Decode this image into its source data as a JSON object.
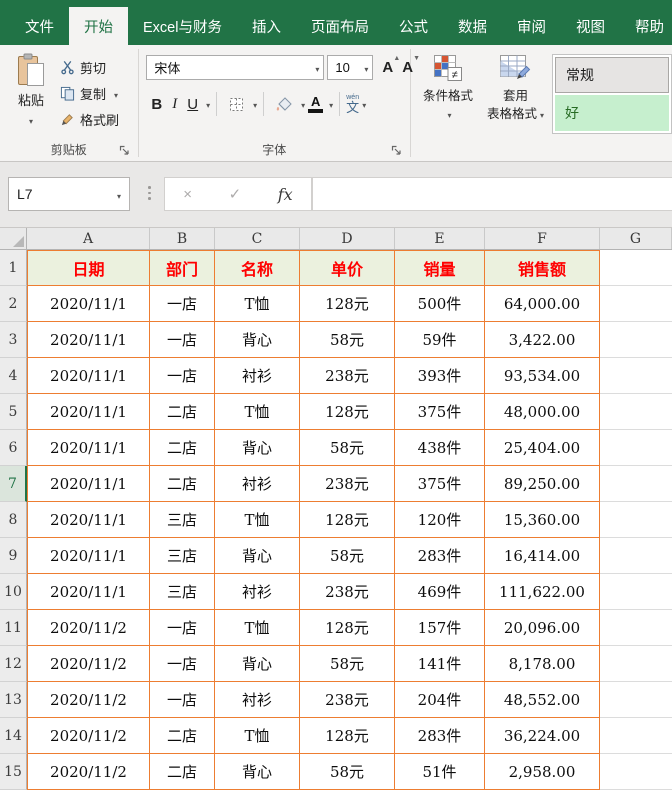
{
  "tabs": [
    "文件",
    "开始",
    "Excel与财务",
    "插入",
    "页面布局",
    "公式",
    "数据",
    "审阅",
    "视图",
    "帮助"
  ],
  "ribbon": {
    "clipboard": {
      "group_label": "剪贴板",
      "paste": "粘贴",
      "cut": "剪切",
      "copy": "复制",
      "format_painter": "格式刷"
    },
    "font": {
      "group_label": "字体",
      "font_name": "宋体",
      "font_size": "10",
      "bold": "B",
      "italic": "I",
      "underline": "U",
      "grow": "A",
      "shrink": "A",
      "font_color_letter": "A",
      "phonetic_small": "wén",
      "phonetic_main": "文"
    },
    "styles": {
      "conditional_label": "条件格式",
      "format_table_line1": "套用",
      "format_table_line2": "表格格式",
      "neq": "≠",
      "style_normal": "常规",
      "style_good": "好"
    }
  },
  "formula_bar": {
    "name_box": "L7",
    "cancel": "×",
    "enter": "✓",
    "fx": "fx",
    "formula": ""
  },
  "grid": {
    "column_headers": [
      "A",
      "B",
      "C",
      "D",
      "E",
      "F",
      "G"
    ],
    "header_row_number": "1",
    "header_labels": [
      "日期",
      "部门",
      "名称",
      "单价",
      "销量",
      "销售额"
    ],
    "selected_cell": "L7",
    "selected_row": 7,
    "rows": [
      {
        "n": "2",
        "cells": [
          "2020/11/1",
          "一店",
          "T恤",
          "128元",
          "500件",
          "64,000.00"
        ]
      },
      {
        "n": "3",
        "cells": [
          "2020/11/1",
          "一店",
          "背心",
          "58元",
          "59件",
          "3,422.00"
        ]
      },
      {
        "n": "4",
        "cells": [
          "2020/11/1",
          "一店",
          "衬衫",
          "238元",
          "393件",
          "93,534.00"
        ]
      },
      {
        "n": "5",
        "cells": [
          "2020/11/1",
          "二店",
          "T恤",
          "128元",
          "375件",
          "48,000.00"
        ]
      },
      {
        "n": "6",
        "cells": [
          "2020/11/1",
          "二店",
          "背心",
          "58元",
          "438件",
          "25,404.00"
        ]
      },
      {
        "n": "7",
        "cells": [
          "2020/11/1",
          "二店",
          "衬衫",
          "238元",
          "375件",
          "89,250.00"
        ]
      },
      {
        "n": "8",
        "cells": [
          "2020/11/1",
          "三店",
          "T恤",
          "128元",
          "120件",
          "15,360.00"
        ]
      },
      {
        "n": "9",
        "cells": [
          "2020/11/1",
          "三店",
          "背心",
          "58元",
          "283件",
          "16,414.00"
        ]
      },
      {
        "n": "10",
        "cells": [
          "2020/11/1",
          "三店",
          "衬衫",
          "238元",
          "469件",
          "111,622.00"
        ]
      },
      {
        "n": "11",
        "cells": [
          "2020/11/2",
          "一店",
          "T恤",
          "128元",
          "157件",
          "20,096.00"
        ]
      },
      {
        "n": "12",
        "cells": [
          "2020/11/2",
          "一店",
          "背心",
          "58元",
          "141件",
          "8,178.00"
        ]
      },
      {
        "n": "13",
        "cells": [
          "2020/11/2",
          "一店",
          "衬衫",
          "238元",
          "204件",
          "48,552.00"
        ]
      },
      {
        "n": "14",
        "cells": [
          "2020/11/2",
          "二店",
          "T恤",
          "128元",
          "283件",
          "36,224.00"
        ]
      },
      {
        "n": "15",
        "cells": [
          "2020/11/2",
          "二店",
          "背心",
          "58元",
          "51件",
          "2,958.00"
        ]
      }
    ]
  },
  "colors": {
    "excel_green": "#217346",
    "table_border": "#ED7D31",
    "header_fill": "#EBF1DE",
    "header_text": "#FF0000",
    "good_fill": "#C6EFCE",
    "good_text": "#276B24"
  }
}
